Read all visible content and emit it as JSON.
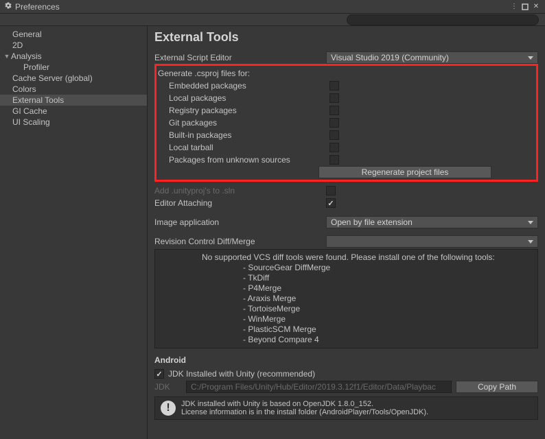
{
  "window": {
    "title": "Preferences"
  },
  "sidebar": {
    "items": [
      {
        "label": "General"
      },
      {
        "label": "2D"
      },
      {
        "label": "Analysis",
        "expandable": true
      },
      {
        "label": "Profiler",
        "child": true
      },
      {
        "label": "Cache Server (global)"
      },
      {
        "label": "Colors"
      },
      {
        "label": "External Tools",
        "selected": true
      },
      {
        "label": "GI Cache"
      },
      {
        "label": "UI Scaling"
      }
    ]
  },
  "main": {
    "heading": "External Tools",
    "script_editor_label": "External Script Editor",
    "script_editor_value": "Visual Studio 2019 (Community)",
    "csproj_header": "Generate .csproj files for:",
    "csproj_items": [
      "Embedded packages",
      "Local packages",
      "Registry packages",
      "Git packages",
      "Built-in packages",
      "Local tarball",
      "Packages from unknown sources"
    ],
    "regen_button": "Regenerate project files",
    "add_unityproj_label": "Add .unityproj's to .sln",
    "editor_attaching_label": "Editor Attaching",
    "image_app_label": "Image application",
    "image_app_value": "Open by file extension",
    "revision_label": "Revision Control Diff/Merge",
    "vcs_message": "No supported VCS diff tools were found. Please install one of the following tools:",
    "vcs_tools": [
      "- SourceGear DiffMerge",
      "- TkDiff",
      "- P4Merge",
      "- Araxis Merge",
      "- TortoiseMerge",
      "- WinMerge",
      "- PlasticSCM Merge",
      "- Beyond Compare 4"
    ],
    "android_header": "Android",
    "jdk_checkbox_label": "JDK Installed with Unity (recommended)",
    "jdk_label": "JDK",
    "jdk_path": "C:/Program Files/Unity/Hub/Editor/2019.3.12f1/Editor/Data/Playbac",
    "copy_path_btn": "Copy Path",
    "jdk_info_line1": "JDK installed with Unity is based on OpenJDK 1.8.0_152.",
    "jdk_info_line2": "License information is in the install folder (AndroidPlayer/Tools/OpenJDK)."
  }
}
